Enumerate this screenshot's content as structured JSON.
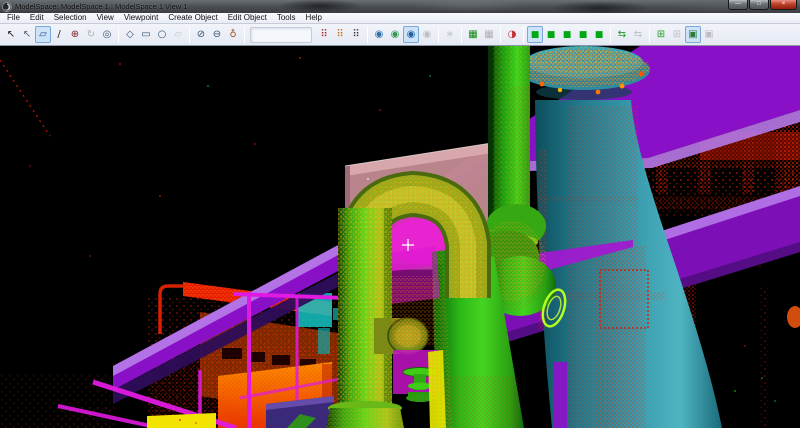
{
  "window": {
    "title": "ModelSpace: ModelSpace 1 : ModelSpace 1 View 1",
    "controls": [
      {
        "name": "minimize-button",
        "glyph": "—"
      },
      {
        "name": "maximize-button",
        "glyph": "□"
      },
      {
        "name": "close-button",
        "glyph": "×"
      }
    ]
  },
  "menu": {
    "items": [
      "File",
      "Edit",
      "Selection",
      "View",
      "Viewpoint",
      "Create Object",
      "Edit Object",
      "Tools",
      "Help"
    ]
  },
  "toolbar": {
    "gap_before_group": 3,
    "groups": [
      {
        "icons": [
          {
            "name": "select-arrow",
            "glyph": "↖",
            "color": "#1a1a1a",
            "state": "normal"
          },
          {
            "name": "multi-select-arrow",
            "glyph": "↖",
            "color": "#5a5f66",
            "state": "normal"
          },
          {
            "name": "fence-select",
            "glyph": "▱",
            "color": "#2a4a8a",
            "state": "pressed"
          },
          {
            "name": "draw-line",
            "glyph": "/",
            "color": "#1a1a1a",
            "state": "normal"
          },
          {
            "name": "pan-tool",
            "glyph": "⊕",
            "color": "#7a2020",
            "state": "normal"
          },
          {
            "name": "rotate-tool",
            "glyph": "↻",
            "color": "#555555",
            "state": "disabled"
          },
          {
            "name": "orbit-tool",
            "glyph": "◎",
            "color": "#33506e",
            "state": "normal"
          }
        ]
      },
      {
        "icons": [
          {
            "name": "fence-polygon",
            "glyph": "◇",
            "color": "#33506e",
            "state": "normal"
          },
          {
            "name": "fence-rectangle",
            "glyph": "▭",
            "color": "#33506e",
            "state": "normal"
          },
          {
            "name": "fence-circle",
            "glyph": "○",
            "color": "#33506e",
            "state": "normal"
          },
          {
            "name": "fence-clear",
            "glyph": "▱",
            "color": "#888888",
            "state": "disabled"
          }
        ]
      },
      {
        "icons": [
          {
            "name": "hide-inside-fence",
            "glyph": "⊘",
            "color": "#33506e",
            "state": "normal"
          },
          {
            "name": "hide-outside-fence",
            "glyph": "⊖",
            "color": "#33506e",
            "state": "normal"
          },
          {
            "name": "scanner-position",
            "glyph": "♁",
            "color": "#9a5a20",
            "state": "normal"
          }
        ]
      },
      {
        "icons": [
          {
            "name": "cloud-color-map",
            "glyph": "⠿",
            "color": "#b02020",
            "state": "normal"
          },
          {
            "name": "cloud-rgb-map",
            "glyph": "⠿",
            "color": "#c86a10",
            "state": "normal"
          },
          {
            "name": "cloud-intensity-map",
            "glyph": "⠿",
            "color": "#383838",
            "state": "normal"
          }
        ]
      },
      {
        "icons": [
          {
            "name": "view-all-clouds",
            "glyph": "◉",
            "color": "#2d6fa8",
            "state": "normal"
          },
          {
            "name": "view-selected-cloud",
            "glyph": "◉",
            "color": "#2f9a50",
            "state": "normal"
          },
          {
            "name": "view-mode-current",
            "glyph": "◉",
            "color": "#1f5f9f",
            "state": "pressed"
          },
          {
            "name": "view-hidden-points",
            "glyph": "◉",
            "color": "#777777",
            "state": "disabled"
          }
        ]
      },
      {
        "icons": [
          {
            "name": "regenerate-cloud",
            "glyph": "∗",
            "color": "#2aa8a8",
            "state": "disabled"
          }
        ]
      },
      {
        "icons": [
          {
            "name": "point-density-grid",
            "glyph": "▦",
            "color": "#108810",
            "state": "normal"
          },
          {
            "name": "point-density-alt",
            "glyph": "▦",
            "color": "#555555",
            "state": "disabled"
          }
        ]
      },
      {
        "icons": [
          {
            "name": "refresh-point-cloud",
            "glyph": "◑",
            "color": "#c03030",
            "state": "normal"
          }
        ]
      },
      {
        "icons": [
          {
            "name": "point-size-1",
            "glyph": "■",
            "color": "#00a814",
            "state": "pressed"
          },
          {
            "name": "point-size-2",
            "glyph": "■",
            "color": "#00a814",
            "state": "normal"
          },
          {
            "name": "point-size-3",
            "glyph": "■",
            "color": "#00a814",
            "state": "normal"
          },
          {
            "name": "point-size-4",
            "glyph": "■",
            "color": "#00a814",
            "state": "normal"
          },
          {
            "name": "point-size-5",
            "glyph": "■",
            "color": "#00a814",
            "state": "normal"
          }
        ]
      },
      {
        "icons": [
          {
            "name": "update-database",
            "glyph": "⇆",
            "color": "#20a020",
            "state": "normal"
          },
          {
            "name": "sync-database",
            "glyph": "⇆",
            "color": "#777777",
            "state": "disabled"
          }
        ]
      },
      {
        "icons": [
          {
            "name": "copy-viewpoint",
            "glyph": "⊞",
            "color": "#20a020",
            "state": "normal"
          },
          {
            "name": "paste-viewpoint",
            "glyph": "⊞",
            "color": "#777777",
            "state": "disabled"
          },
          {
            "name": "capture-image",
            "glyph": "▣",
            "color": "#2f7a3a",
            "state": "pressed"
          },
          {
            "name": "capture-image-alt",
            "glyph": "▣",
            "color": "#777777",
            "state": "disabled"
          }
        ]
      }
    ]
  },
  "scene": {
    "type": "3d-point-cloud-viewport",
    "background": "#000000",
    "colors": {
      "beam": "#8a10c8",
      "beam_light": "#b579e8",
      "beam_dark": "#2e0d58",
      "beam_lower": "#7c0fb6",
      "box": "#c08891",
      "box_top": "#d9a9ad",
      "glow": "#e018c8",
      "magenta_pipe": "#e01ae0",
      "yellow_cabinet": "#f2e400",
      "indigo_slab": "#3a2878",
      "teal_panel": "#14c4c4",
      "red_structure": "#e02000",
      "furnace_orange": "#ff7000",
      "crosshair": "#ffffff"
    },
    "objects": [
      {
        "name": "pipe-rack-beam-upper",
        "color": "#8a10c8"
      },
      {
        "name": "pipe-rack-beam-lower",
        "color": "#7c0fb6"
      },
      {
        "name": "concrete-box",
        "color": "#c08891"
      },
      {
        "name": "chimney-cylinder",
        "color": "#3598aa"
      },
      {
        "name": "green-pipes",
        "color": "#3ed41c"
      },
      {
        "name": "pipe-elbow-arch",
        "color": "#96aa1e"
      },
      {
        "name": "red-girder-structure",
        "color": "#e02000"
      },
      {
        "name": "magenta-pipes",
        "color": "#e01ae0"
      },
      {
        "name": "yellow-cabinet",
        "color": "#f2e400"
      },
      {
        "name": "crosshair-cursor",
        "color": "#ffffff"
      }
    ]
  }
}
